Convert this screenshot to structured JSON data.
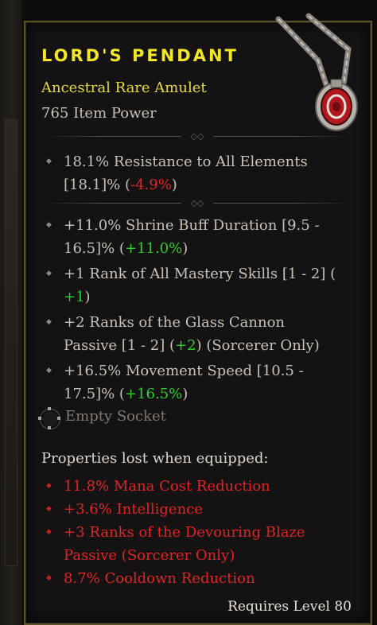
{
  "item": {
    "name": "LORD'S PENDANT",
    "type": "Ancestral Rare Amulet",
    "power": "765 Item Power"
  },
  "stats": [
    {
      "lines": [
        "18.1% Resistance to All Elements",
        "[18.1]% (",
        "-4.9%",
        ")"
      ]
    },
    {
      "lines": [
        "+11.0% Shrine Buff Duration [9.5 -",
        "16.5]% (",
        "+11.0%",
        ")"
      ]
    },
    {
      "lines": [
        "+1 Rank of All Mastery Skills [1 - 2] (",
        "",
        "+1",
        ")"
      ]
    },
    {
      "lines": [
        "+2 Ranks of the Glass Cannon",
        "Passive [1 - 2] (",
        "+2",
        ") (Sorcerer Only)"
      ]
    },
    {
      "lines": [
        "+16.5% Movement Speed [10.5 -",
        "17.5]% (",
        "+16.5%",
        ")"
      ]
    }
  ],
  "socket": {
    "label": "Empty Socket",
    "icon": "empty-socket-icon"
  },
  "lost": {
    "title": "Properties lost when equipped:",
    "items": [
      [
        "11.8% Mana Cost Reduction"
      ],
      [
        "+3.6% Intelligence"
      ],
      [
        "+3 Ranks of the Devouring Blaze",
        "Passive (Sorcerer Only)"
      ],
      [
        "8.7% Cooldown Reduction"
      ]
    ]
  },
  "requirement": "Requires Level 80",
  "colors": {
    "title": "#f2e629",
    "subtitle": "#e5dc3a",
    "stat_text": "#c9c2b6",
    "negative": "#e12424",
    "positive": "#29d12c",
    "lost": "#e12424",
    "border": "#5b5228"
  },
  "icons": {
    "bullet": "diamond-bullet-icon",
    "amulet": "amulet-icon",
    "divider": "divider-ornament-icon"
  }
}
